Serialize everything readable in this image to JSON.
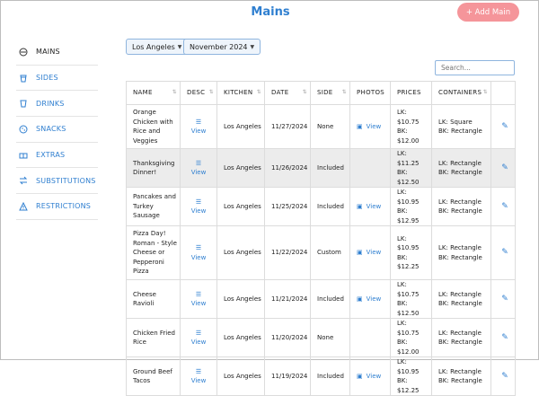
{
  "header": {
    "title": "Mains",
    "add_button": "+ Add Main"
  },
  "sidebar": {
    "items": [
      {
        "label": "MAINS",
        "icon": "bowl-icon",
        "active": true
      },
      {
        "label": "SIDES",
        "icon": "cup-icon"
      },
      {
        "label": "DRINKS",
        "icon": "glass-icon"
      },
      {
        "label": "SNACKS",
        "icon": "cookie-icon"
      },
      {
        "label": "EXTRAS",
        "icon": "tray-icon"
      },
      {
        "label": "SUBSTITUTIONS",
        "icon": "swap-icon"
      },
      {
        "label": "RESTRICTIONS",
        "icon": "warning-icon"
      }
    ]
  },
  "filters": {
    "location": "Los Angeles",
    "date": "November 2024"
  },
  "search": {
    "placeholder": "Search..."
  },
  "table": {
    "columns": [
      "NAME",
      "DESC",
      "KITCHEN",
      "DATE",
      "SIDE",
      "PHOTOS",
      "PRICES",
      "CONTAINERS",
      ""
    ],
    "rows": [
      {
        "name": "Orange Chicken with Rice and Veggies",
        "desc": "View",
        "kitchen": "Los Angeles",
        "date": "11/27/2024",
        "side": "None",
        "photos": "View",
        "price_lk": "LK: $10.75",
        "price_bk": "BK: $12.00",
        "container_lk": "LK: Square",
        "container_bk": "BK: Rectangle"
      },
      {
        "name": "Thanksgiving Dinner!",
        "desc": "View",
        "kitchen": "Los Angeles",
        "date": "11/26/2024",
        "side": "Included",
        "photos": "",
        "price_lk": "LK: $11.25",
        "price_bk": "BK: $12.50",
        "container_lk": "LK: Rectangle",
        "container_bk": "BK: Rectangle",
        "highlight": true
      },
      {
        "name": "Pancakes and Turkey Sausage",
        "desc": "View",
        "kitchen": "Los Angeles",
        "date": "11/25/2024",
        "side": "Included",
        "photos": "View",
        "price_lk": "LK: $10.95",
        "price_bk": "BK: $12.95",
        "container_lk": "LK: Rectangle",
        "container_bk": "BK: Rectangle"
      },
      {
        "name": "Pizza Day! Roman - Style Cheese or Pepperoni Pizza",
        "desc": "View",
        "kitchen": "Los Angeles",
        "date": "11/22/2024",
        "side": "Custom",
        "photos": "View",
        "price_lk": "LK: $10.95",
        "price_bk": "BK: $12.25",
        "container_lk": "LK: Rectangle",
        "container_bk": "BK: Rectangle"
      },
      {
        "name": "Cheese Ravioli",
        "desc": "View",
        "kitchen": "Los Angeles",
        "date": "11/21/2024",
        "side": "Included",
        "photos": "View",
        "price_lk": "LK: $10.75",
        "price_bk": "BK: $12.50",
        "container_lk": "LK: Rectangle",
        "container_bk": "BK: Rectangle"
      },
      {
        "name": "Chicken Fried Rice",
        "desc": "View",
        "kitchen": "Los Angeles",
        "date": "11/20/2024",
        "side": "None",
        "photos": "",
        "price_lk": "LK: $10.75",
        "price_bk": "BK: $12.00",
        "container_lk": "LK: Rectangle",
        "container_bk": "BK: Rectangle"
      },
      {
        "name": "Ground Beef Tacos",
        "desc": "View",
        "kitchen": "Los Angeles",
        "date": "11/19/2024",
        "side": "Included",
        "photos": "View",
        "price_lk": "LK: $10.95",
        "price_bk": "BK: $12.25",
        "container_lk": "LK: Rectangle",
        "container_bk": "BK: Rectangle"
      }
    ]
  }
}
